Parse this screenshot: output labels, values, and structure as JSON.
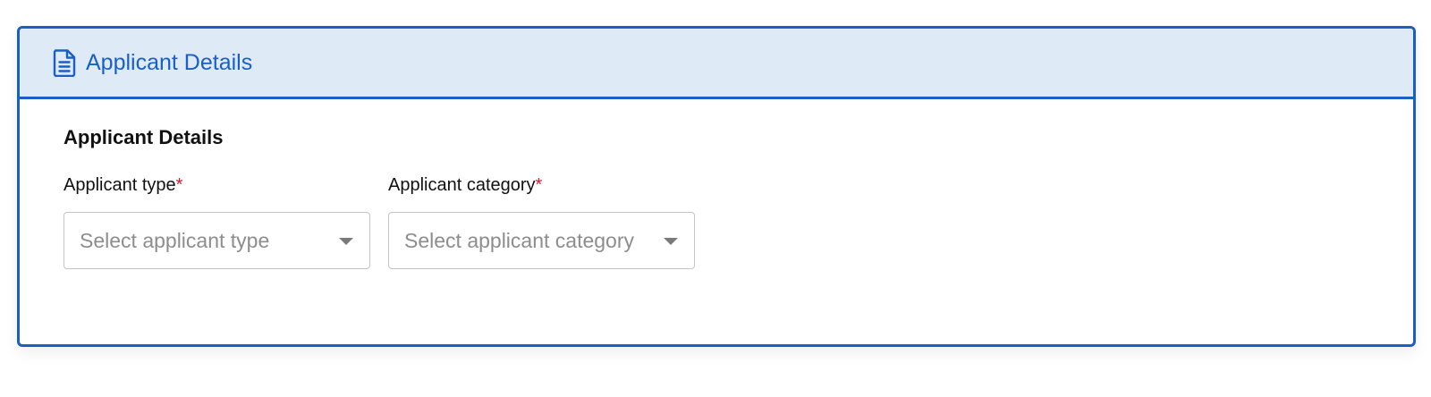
{
  "header": {
    "title": "Applicant Details",
    "icon": "document-icon",
    "accent_color": "#1a5fc8",
    "background_color": "#deeaf6"
  },
  "section": {
    "title": "Applicant Details"
  },
  "fields": {
    "applicant_type": {
      "label": "Applicant type",
      "required_mark": "*",
      "placeholder": "Select applicant type"
    },
    "applicant_category": {
      "label": "Applicant category",
      "required_mark": "*",
      "placeholder": "Select applicant category"
    }
  }
}
